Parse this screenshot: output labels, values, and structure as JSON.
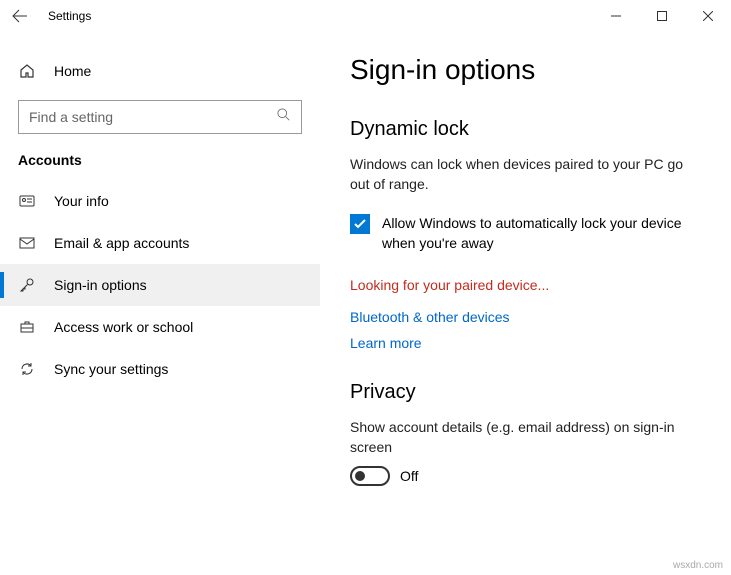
{
  "window": {
    "title": "Settings"
  },
  "sidebar": {
    "home_label": "Home",
    "search_placeholder": "Find a setting",
    "category": "Accounts",
    "items": [
      {
        "label": "Your info"
      },
      {
        "label": "Email & app accounts"
      },
      {
        "label": "Sign-in options"
      },
      {
        "label": "Access work or school"
      },
      {
        "label": "Sync your settings"
      }
    ]
  },
  "main": {
    "title": "Sign-in options",
    "dynamic_lock": {
      "heading": "Dynamic lock",
      "description": "Windows can lock when devices paired to your PC go out of range.",
      "checkbox_label": "Allow Windows to automatically lock your device when you're away",
      "checkbox_checked": true,
      "status": "Looking for your paired device...",
      "link_bluetooth": "Bluetooth & other devices",
      "link_learn": "Learn more"
    },
    "privacy": {
      "heading": "Privacy",
      "description": "Show account details (e.g. email address) on sign-in screen",
      "toggle_state": "Off"
    }
  },
  "watermark": "wsxdn.com"
}
